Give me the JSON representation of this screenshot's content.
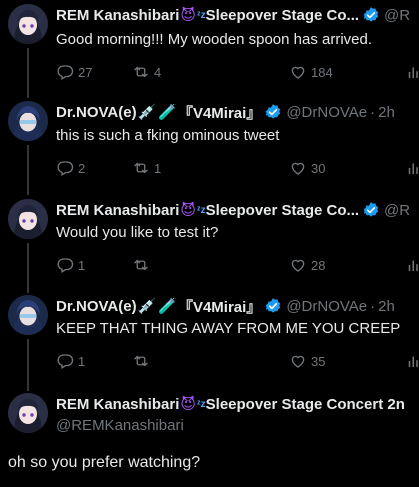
{
  "tweets": [
    {
      "name": "REM Kanashibari",
      "decoration": "Sleepover Stage Co...",
      "handle_tail": "@R",
      "text": "Good morning!!! My wooden spoon has arrived.",
      "replies": "27",
      "retweets": "4",
      "likes": "184",
      "avatar": "rem-avatar"
    },
    {
      "name": "Dr.NOVA(e)",
      "decoration": "『V4Mirai』",
      "handle": "@DrNOVAe",
      "time": "2h",
      "text": "this is such a fking ominous tweet",
      "replies": "2",
      "retweets": "1",
      "likes": "30",
      "avatar": "nova-avatar"
    },
    {
      "name": "REM Kanashibari",
      "decoration": "Sleepover Stage Co...",
      "handle_tail": "@R",
      "text": "Would you like to test it?",
      "replies": "1",
      "retweets": "",
      "likes": "28",
      "avatar": "rem-avatar"
    },
    {
      "name": "Dr.NOVA(e)",
      "decoration": "『V4Mirai』",
      "handle": "@DrNOVAe",
      "time": "2h",
      "text": "KEEP THAT THING AWAY FROM ME YOU CREEP",
      "replies": "1",
      "retweets": "",
      "likes": "35",
      "avatar": "nova-avatar"
    }
  ],
  "focused": {
    "name": "REM Kanashibari",
    "decoration": "Sleepover Stage Concert 2n",
    "handle": "@REMKanashibari",
    "text": "oh so you prefer watching?"
  },
  "dot": "·",
  "colors": {
    "background": "#000000",
    "text": "#e7e9ea",
    "muted": "#71767b",
    "verified": "#1d9bf0",
    "connector": "#333639"
  }
}
